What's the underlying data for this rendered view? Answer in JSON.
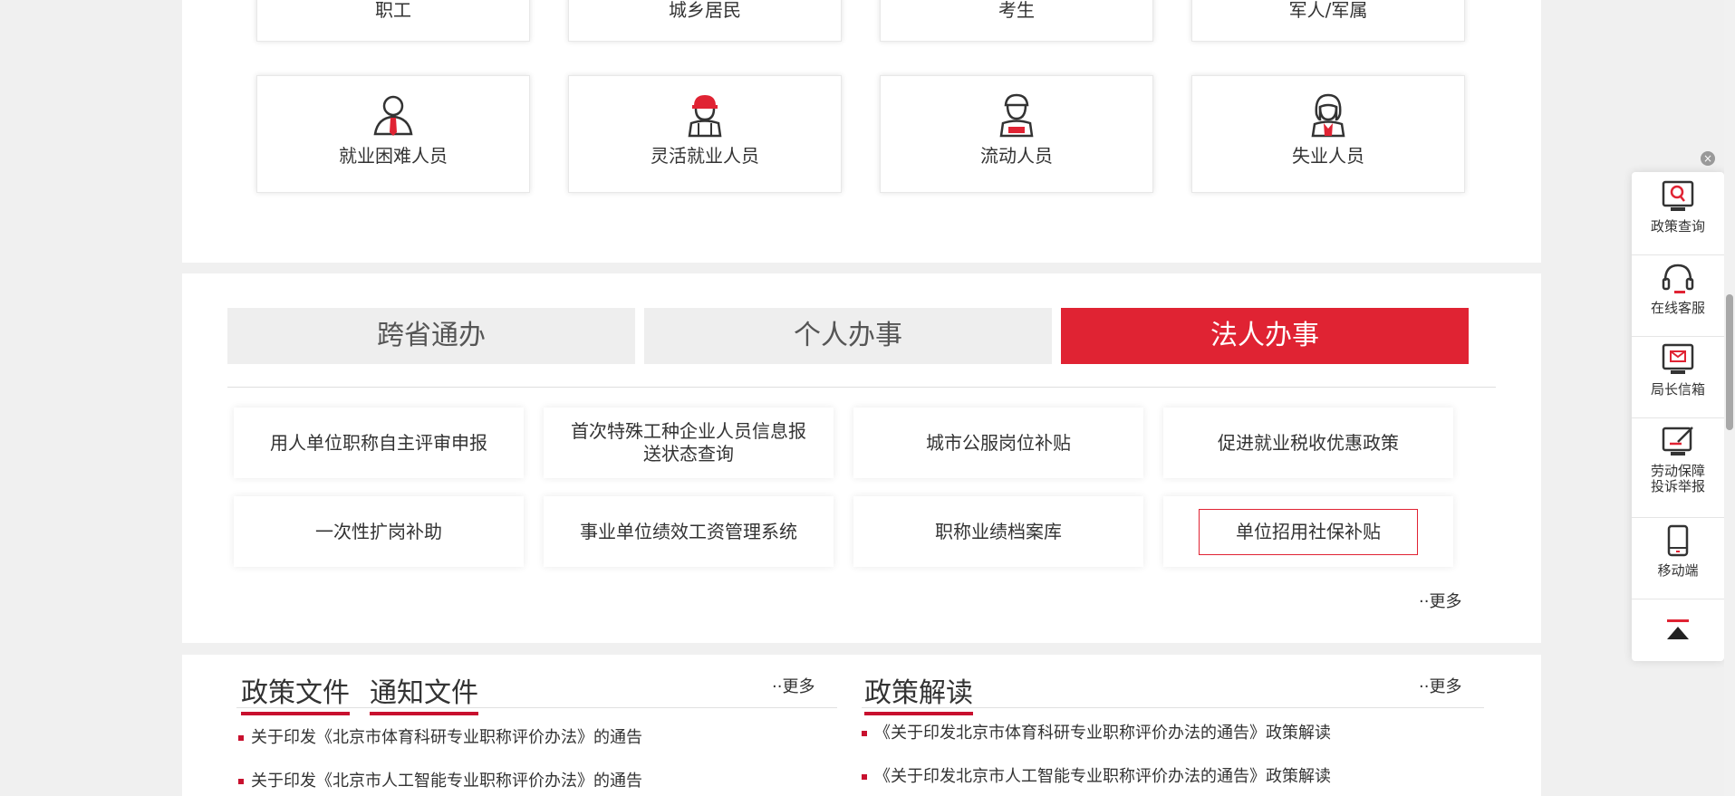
{
  "persons_top": [
    "职工",
    "城乡居民",
    "考生",
    "军人/军属"
  ],
  "persons_bottom": [
    {
      "label": "就业困难人员",
      "icon": "person-tie-icon"
    },
    {
      "label": "灵活就业人员",
      "icon": "worker-helmet-icon"
    },
    {
      "label": "流动人员",
      "icon": "person-cap-icon"
    },
    {
      "label": "失业人员",
      "icon": "woman-icon"
    }
  ],
  "tabs": [
    "跨省通办",
    "个人办事",
    "法人办事"
  ],
  "active_tab": "法人办事",
  "services": [
    "用人单位职称自主评审申报",
    "首次特殊工种企业人员信息报送状态查询",
    "城市公服岗位补贴",
    "促进就业税收优惠政策",
    "一次性扩岗补助",
    "事业单位绩效工资管理系统",
    "职称业绩档案库",
    "单位招用社保补贴"
  ],
  "more_label": "··更多",
  "policy": {
    "tabs": [
      "政策文件",
      "通知文件"
    ],
    "items": [
      "关于印发《北京市体育科研专业职称评价办法》的通告",
      "关于印发《北京市人工智能专业职称评价办法》的通告"
    ]
  },
  "interpret": {
    "title": "政策解读",
    "items": [
      "《关于印发北京市体育科研专业职称评价办法的通告》政策解读",
      "《关于印发北京市人工智能专业职称评价办法的通告》政策解读"
    ]
  },
  "sidebar": [
    {
      "label": "政策查询",
      "icon": "policy-search-icon"
    },
    {
      "label": "在线客服",
      "icon": "headset-icon"
    },
    {
      "label": "局长信箱",
      "icon": "mailbox-icon"
    },
    {
      "label": "劳动保障投诉举报",
      "icon": "complaint-icon"
    },
    {
      "label": "移动端",
      "icon": "mobile-icon"
    }
  ],
  "sidebar_close": "×",
  "colors": {
    "accent": "#e02333",
    "dark_red": "#c8102e",
    "background": "#f0f0f0"
  }
}
